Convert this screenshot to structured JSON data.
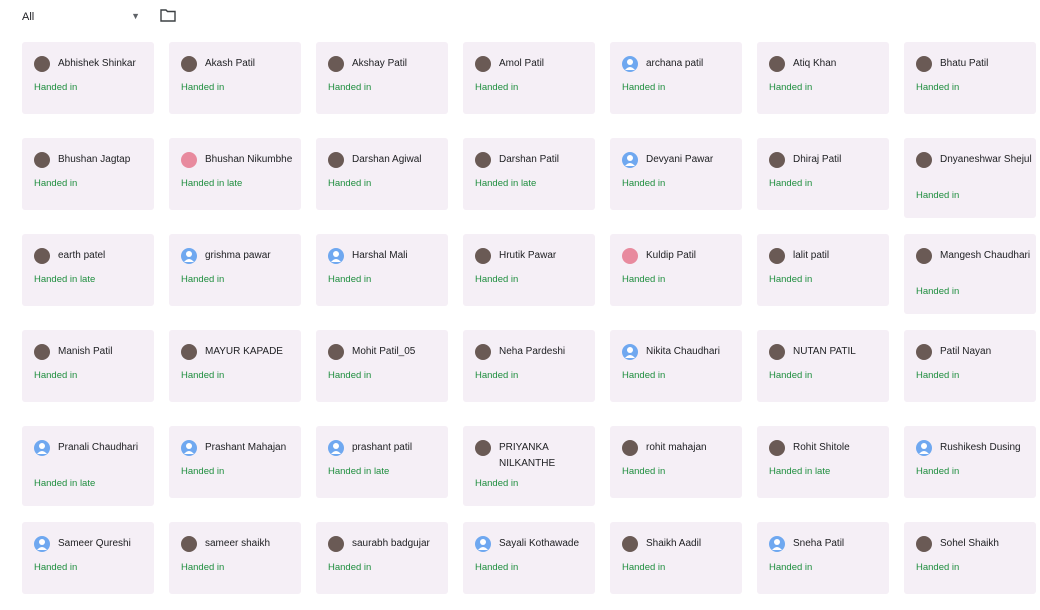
{
  "filter": {
    "selected": "All",
    "caret": "▼"
  },
  "students": [
    {
      "name": "Abhishek Shinkar",
      "status": "Handed in",
      "avatar": "photo-avatar"
    },
    {
      "name": "Akash Patil",
      "status": "Handed in",
      "avatar": "photo-avatar"
    },
    {
      "name": "Akshay Patil",
      "status": "Handed in",
      "avatar": "photo-avatar"
    },
    {
      "name": "Amol Patil",
      "status": "Handed in",
      "avatar": "photo-avatar"
    },
    {
      "name": "archana patil",
      "status": "Handed in",
      "avatar": "default-avatar"
    },
    {
      "name": "Atiq Khan",
      "status": "Handed in",
      "avatar": "photo-avatar"
    },
    {
      "name": "Bhatu Patil",
      "status": "Handed in",
      "avatar": "photo-avatar"
    },
    {
      "name": "Bhushan Jagtap",
      "status": "Handed in",
      "avatar": "photo-avatar"
    },
    {
      "name": "Bhushan Nikumbhe",
      "status": "Handed in late",
      "avatar": "pink-avatar"
    },
    {
      "name": "Darshan Agiwal",
      "status": "Handed in",
      "avatar": "photo-avatar"
    },
    {
      "name": "Darshan Patil",
      "status": "Handed in late",
      "avatar": "photo-avatar"
    },
    {
      "name": "Devyani Pawar",
      "status": "Handed in",
      "avatar": "default-avatar"
    },
    {
      "name": "Dhiraj Patil",
      "status": "Handed in",
      "avatar": "photo-avatar"
    },
    {
      "name": "Dnyaneshwar Shejul",
      "status": "Handed in",
      "avatar": "photo-avatar"
    },
    {
      "name": "earth patel",
      "status": "Handed in late",
      "avatar": "photo-avatar"
    },
    {
      "name": "grishma pawar",
      "status": "Handed in",
      "avatar": "default-avatar"
    },
    {
      "name": "Harshal Mali",
      "status": "Handed in",
      "avatar": "default-avatar"
    },
    {
      "name": "Hrutik Pawar",
      "status": "Handed in",
      "avatar": "photo-avatar"
    },
    {
      "name": "Kuldip Patil",
      "status": "Handed in",
      "avatar": "pink-avatar"
    },
    {
      "name": "lalit patil",
      "status": "Handed in",
      "avatar": "photo-avatar"
    },
    {
      "name": "Mangesh Chaudhari",
      "status": "Handed in",
      "avatar": "photo-avatar"
    },
    {
      "name": "Manish Patil",
      "status": "Handed in",
      "avatar": "photo-avatar"
    },
    {
      "name": "MAYUR KAPADE",
      "status": "Handed in",
      "avatar": "photo-avatar"
    },
    {
      "name": "Mohit Patil_05",
      "status": "Handed in",
      "avatar": "photo-avatar"
    },
    {
      "name": "Neha Pardeshi",
      "status": "Handed in",
      "avatar": "photo-avatar"
    },
    {
      "name": "Nikita Chaudhari",
      "status": "Handed in",
      "avatar": "default-avatar"
    },
    {
      "name": "NUTAN PATIL",
      "status": "Handed in",
      "avatar": "photo-avatar"
    },
    {
      "name": "Patil Nayan",
      "status": "Handed in",
      "avatar": "photo-avatar"
    },
    {
      "name": "Pranali Chaudhari",
      "status": "Handed in late",
      "avatar": "default-avatar"
    },
    {
      "name": "Prashant Mahajan",
      "status": "Handed in",
      "avatar": "default-avatar"
    },
    {
      "name": "prashant patil",
      "status": "Handed in late",
      "avatar": "default-avatar"
    },
    {
      "name": "PRIYANKA NILKANTHE",
      "status": "Handed in",
      "avatar": "photo-avatar"
    },
    {
      "name": "rohit mahajan",
      "status": "Handed in",
      "avatar": "photo-avatar"
    },
    {
      "name": "Rohit Shitole",
      "status": "Handed in late",
      "avatar": "photo-avatar"
    },
    {
      "name": "Rushikesh Dusing",
      "status": "Handed in",
      "avatar": "default-avatar"
    },
    {
      "name": "Sameer Qureshi",
      "status": "Handed in",
      "avatar": "default-avatar"
    },
    {
      "name": "sameer shaikh",
      "status": "Handed in",
      "avatar": "photo-avatar"
    },
    {
      "name": "saurabh badgujar",
      "status": "Handed in",
      "avatar": "photo-avatar"
    },
    {
      "name": "Sayali Kothawade",
      "status": "Handed in",
      "avatar": "default-avatar"
    },
    {
      "name": "Shaikh Aadil",
      "status": "Handed in",
      "avatar": "photo-avatar"
    },
    {
      "name": "Sneha Patil",
      "status": "Handed in",
      "avatar": "default-avatar"
    },
    {
      "name": "Sohel Shaikh",
      "status": "Handed in",
      "avatar": "photo-avatar"
    }
  ],
  "colors": {
    "status_green": "#1e8e3e",
    "card_bg": "#f5eff6",
    "default_avatar": "#6fa8f0"
  }
}
